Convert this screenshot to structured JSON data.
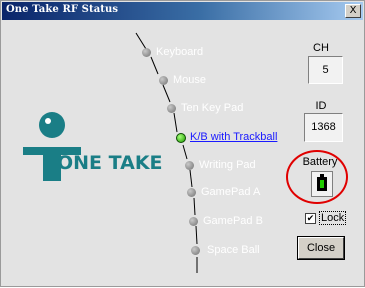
{
  "window": {
    "title": "One Take RF Status",
    "close_glyph": "X"
  },
  "devices": [
    {
      "label": "Keyboard",
      "active": false
    },
    {
      "label": "Mouse",
      "active": false
    },
    {
      "label": "Ten Key Pad",
      "active": false
    },
    {
      "label": "K/B with Trackball",
      "active": true
    },
    {
      "label": "Writing Pad",
      "active": false
    },
    {
      "label": "GamePad A",
      "active": false
    },
    {
      "label": "GamePad B",
      "active": false
    },
    {
      "label": "Space Ball",
      "active": false
    }
  ],
  "ch": {
    "label": "CH",
    "value": "5"
  },
  "id": {
    "label": "ID",
    "value": "1368"
  },
  "battery": {
    "label": "Battery",
    "icon": "battery-icon",
    "status_color": "#1fcc00"
  },
  "lock": {
    "checked": true,
    "label": "Lock",
    "check_glyph": "✔"
  },
  "close_button": {
    "label": "Close"
  },
  "logo": {
    "text": "ONE TAKE",
    "color": "#1a7e86"
  },
  "colors": {
    "active_dot": "#1f9d00",
    "highlight": "#e00000",
    "link": "#1a1aff"
  }
}
